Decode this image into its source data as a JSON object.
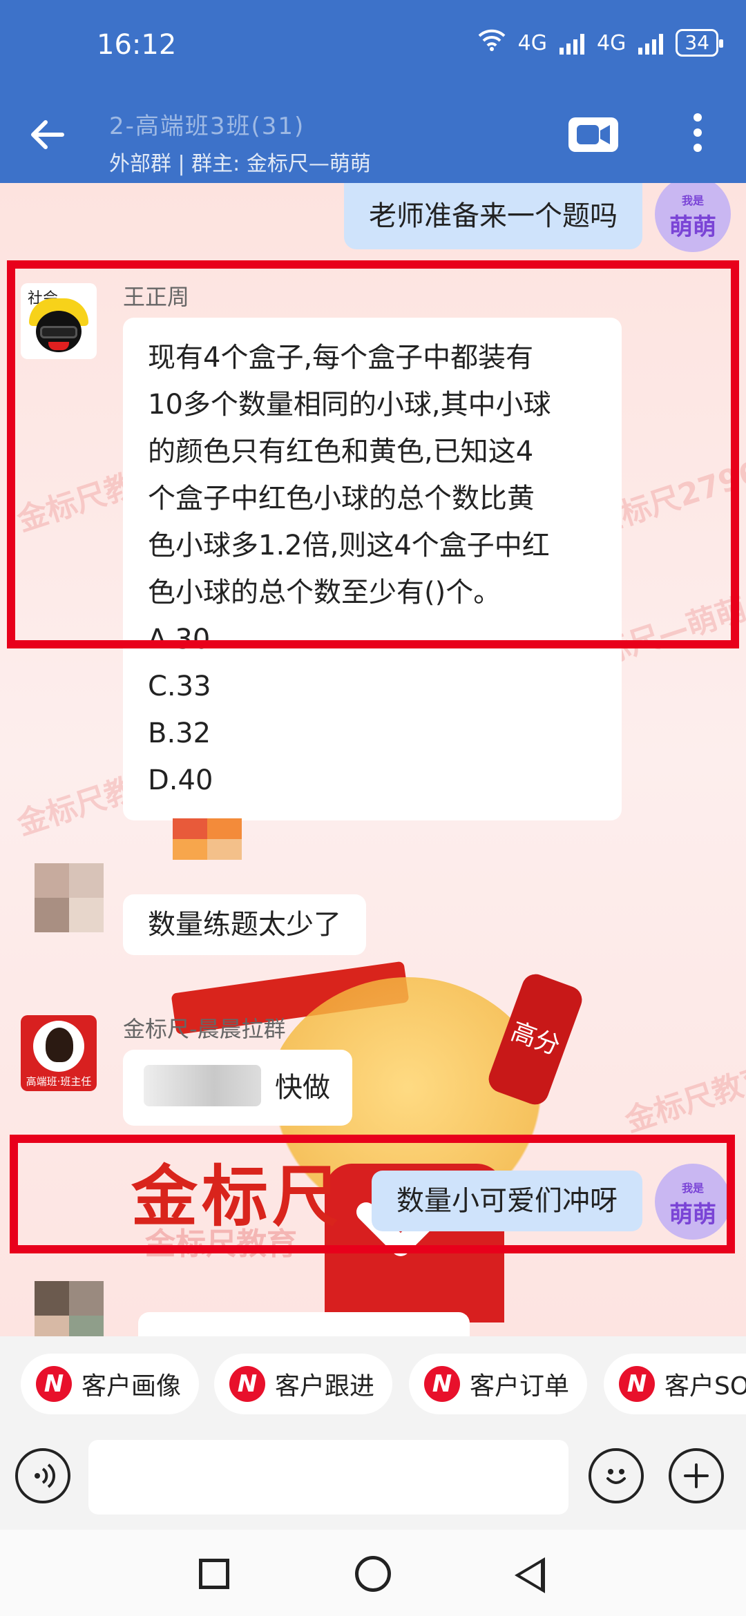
{
  "status": {
    "time": "16:12",
    "net1": "4G",
    "net2": "4G",
    "battery": "34"
  },
  "header": {
    "title": "2-高端班3班(31)",
    "subtitle": "外部群 | 群主: 金标尺—萌萌"
  },
  "messages": [
    {
      "id": "m1",
      "text": "老师准备来一个题吗",
      "avatar_text": "萌萌",
      "avatar_tag": "我是"
    },
    {
      "id": "m2",
      "sender": "王正周",
      "avatar_tag": "社会",
      "lines": [
        "现有4个盒子,每个盒子中都装有",
        "10多个数量相同的小球,其中小球",
        "的颜色只有红色和黄色,已知这4",
        "个盒子中红色小球的总个数比黄",
        "色小球多1.2倍,则这4个盒子中红",
        "色小球的总个数至少有()个。",
        "A.30",
        "C.33",
        "B.32",
        "D.40"
      ]
    },
    {
      "id": "m3",
      "text": "数量练题太少了"
    },
    {
      "id": "m4",
      "sender": "金标尺-晨晨拉群",
      "text": "快做",
      "avatar_caption": "高端班·班主任"
    },
    {
      "id": "m5",
      "text": "数量小可爱们冲呀",
      "avatar_text": "萌萌",
      "avatar_tag": "我是"
    }
  ],
  "poster": {
    "title": "金标尺",
    "sub": "金标尺教育",
    "bottle": "高分"
  },
  "watermarks": [
    "金标尺教育",
    "金标尺2796",
    "金标尺—萌萌",
    "金标尺教育",
    "金标尺教育"
  ],
  "quick_actions": [
    {
      "label": "客户画像"
    },
    {
      "label": "客户跟进"
    },
    {
      "label": "客户订单"
    },
    {
      "label": "客户SOP"
    }
  ],
  "colors": {
    "header": "#3d72c9",
    "highlight": "#e8001b",
    "my_bubble": "#cfe3fb",
    "brand_red": "#e8102b"
  },
  "icons": [
    "back-arrow-icon",
    "video-call-icon",
    "more-vert-icon",
    "voice-icon",
    "emoji-icon",
    "plus-icon",
    "wifi-icon",
    "signal-icon",
    "battery-icon"
  ]
}
